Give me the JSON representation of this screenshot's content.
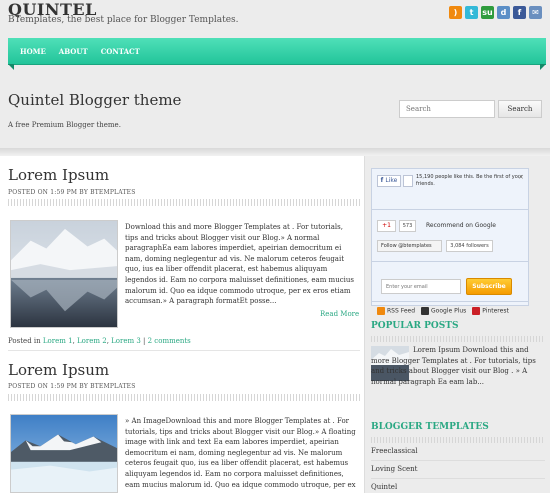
{
  "header": {
    "title": "QUINTEL",
    "subtitle": "BTemplates, the best place for Blogger Templates."
  },
  "social_icons": [
    {
      "icon": "rss-icon",
      "color": "#f0890e",
      "glyph": ")"
    },
    {
      "icon": "twitter-icon",
      "color": "#33b9d8",
      "glyph": "t"
    },
    {
      "icon": "stumbleupon-icon",
      "color": "#2f9c3d",
      "glyph": "su"
    },
    {
      "icon": "digg-icon",
      "color": "#5b8fc7",
      "glyph": "d"
    },
    {
      "icon": "facebook-icon",
      "color": "#3b5998",
      "glyph": "f"
    },
    {
      "icon": "email-icon",
      "color": "#6a8fbf",
      "glyph": "✉"
    }
  ],
  "nav": {
    "items": [
      "HOME",
      "ABOUT",
      "CONTACT"
    ]
  },
  "blog": {
    "title": "Quintel Blogger theme",
    "description": "A free Premium Blogger theme."
  },
  "search": {
    "placeholder": "Search",
    "button": "Search"
  },
  "posts": [
    {
      "title": "Lorem Ipsum",
      "meta": "POSTED ON 1:59 PM BY BTEMPLATES",
      "body": "Download this and more Blogger Templates at . For tutorials, tips and tricks about Blogger visit our Blog.» A normal paragraphEa eam labores imperdiet, apeirian democritum ei nam, doming neglegentur ad vis. Ne malorum ceteros feugait quo, ius ea liber offendit placerat, est habemus aliquyam legendos id. Eam no corpora maluisset definitiones, eam mucius malorum id. Quo ea idque commodo utroque, per ex eros etiam accumsan.» A paragraph formatEt posse...",
      "read_more": "Read More",
      "footer_prefix": "Posted in",
      "labels": [
        "Lorem 1",
        "Lorem 2",
        "Lorem 3"
      ],
      "comments": "2 comments"
    },
    {
      "title": "Lorem Ipsum",
      "meta": "POSTED ON 1:59 PM BY BTEMPLATES",
      "body": "» An ImageDownload this and more Blogger Templates at . For tutorials, tips and tricks about Blogger visit our Blog.» A floating image with link and text Ea eam labores imperdiet, apeirian democritum ei nam, doming neglegentur ad vis. Ne malorum ceteros feugait quo, ius ea liber offendit placerat, est habemus aliquyam legendos id. Eam no corpora maluisset definitiones, eam mucius malorum id. Quo ea idque commodo utroque, per ex eros"
    }
  ],
  "sidebar": {
    "facebook": {
      "like": "Like",
      "text": "15,190 people like this. Be the first of your friends.",
      "close": "×"
    },
    "gplus": {
      "button": "+1",
      "count": "573",
      "text": "Recommend on Google"
    },
    "twitter": {
      "button": "Follow @btemplates",
      "count": "3,084 followers"
    },
    "newsletter": {
      "placeholder": "Enter your email",
      "button": "Subscribe"
    },
    "feeds": [
      "RSS Feed",
      "Google Plus",
      "Pinterest"
    ],
    "popular_heading": "POPULAR POSTS",
    "popular_post": "Lorem Ipsum Download this and more Blogger Templates at . For tutorials, tips and tricks about Blogger visit our Blog . » A normal paragraph Ea eam lab...",
    "templates_heading": "BLOGGER TEMPLATES",
    "templates": [
      "Freeclassical",
      "Loving Scent",
      "Quintel"
    ]
  }
}
